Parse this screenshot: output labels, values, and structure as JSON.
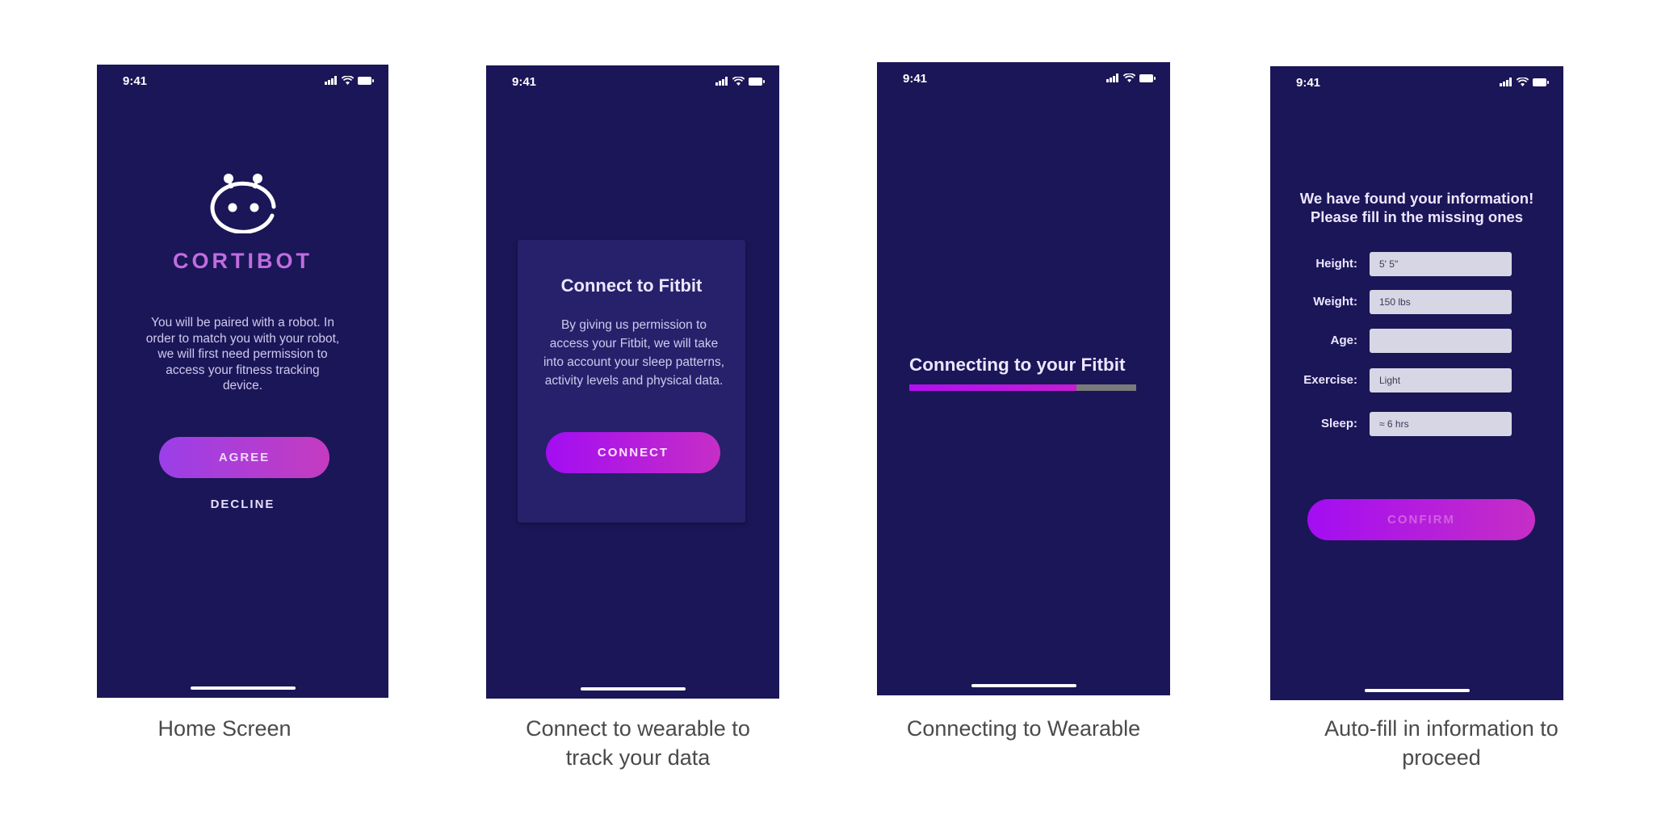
{
  "colors": {
    "phone_background": "#1b1657",
    "card_background": "#26216a",
    "brand_purple": "#c06de0",
    "button_gradient_start": "#a30df2",
    "button_gradient_end": "#c62ec6",
    "progress_track": "#7a7a7a",
    "caption_text": "#4a4a4a"
  },
  "status_bar": {
    "time": "9:41",
    "icons": [
      "signal-icon",
      "wifi-icon",
      "battery-icon"
    ]
  },
  "screens": [
    {
      "caption": "Home Screen",
      "logo_icon": "robot-face-icon",
      "brand": "CORTIBOT",
      "intro": "You will be paired with a robot. In order to match you with your robot, we will first need permission to access your fitness tracking device.",
      "agree_label": "AGREE",
      "decline_label": "DECLINE"
    },
    {
      "caption": "Connect to wearable to track your data",
      "card_title": "Connect to Fitbit",
      "card_body": "By giving us permission to access your Fitbit, we will take into account your sleep patterns, activity levels and physical data.",
      "connect_label": "CONNECT"
    },
    {
      "caption": "Connecting to Wearable",
      "title": "Connecting to your Fitbit",
      "progress": 0.735
    },
    {
      "caption": "Auto-fill in information to proceed",
      "heading": "We have found your information! Please fill in the missing ones",
      "fields": [
        {
          "label": "Height:",
          "value": "5' 5\""
        },
        {
          "label": "Weight:",
          "value": "150 lbs"
        },
        {
          "label": "Age:",
          "value": ""
        },
        {
          "label": "Exercise:",
          "value": "Light"
        },
        {
          "label": "Sleep:",
          "value": "≈ 6 hrs"
        }
      ],
      "confirm_label": "CONFIRM"
    }
  ]
}
